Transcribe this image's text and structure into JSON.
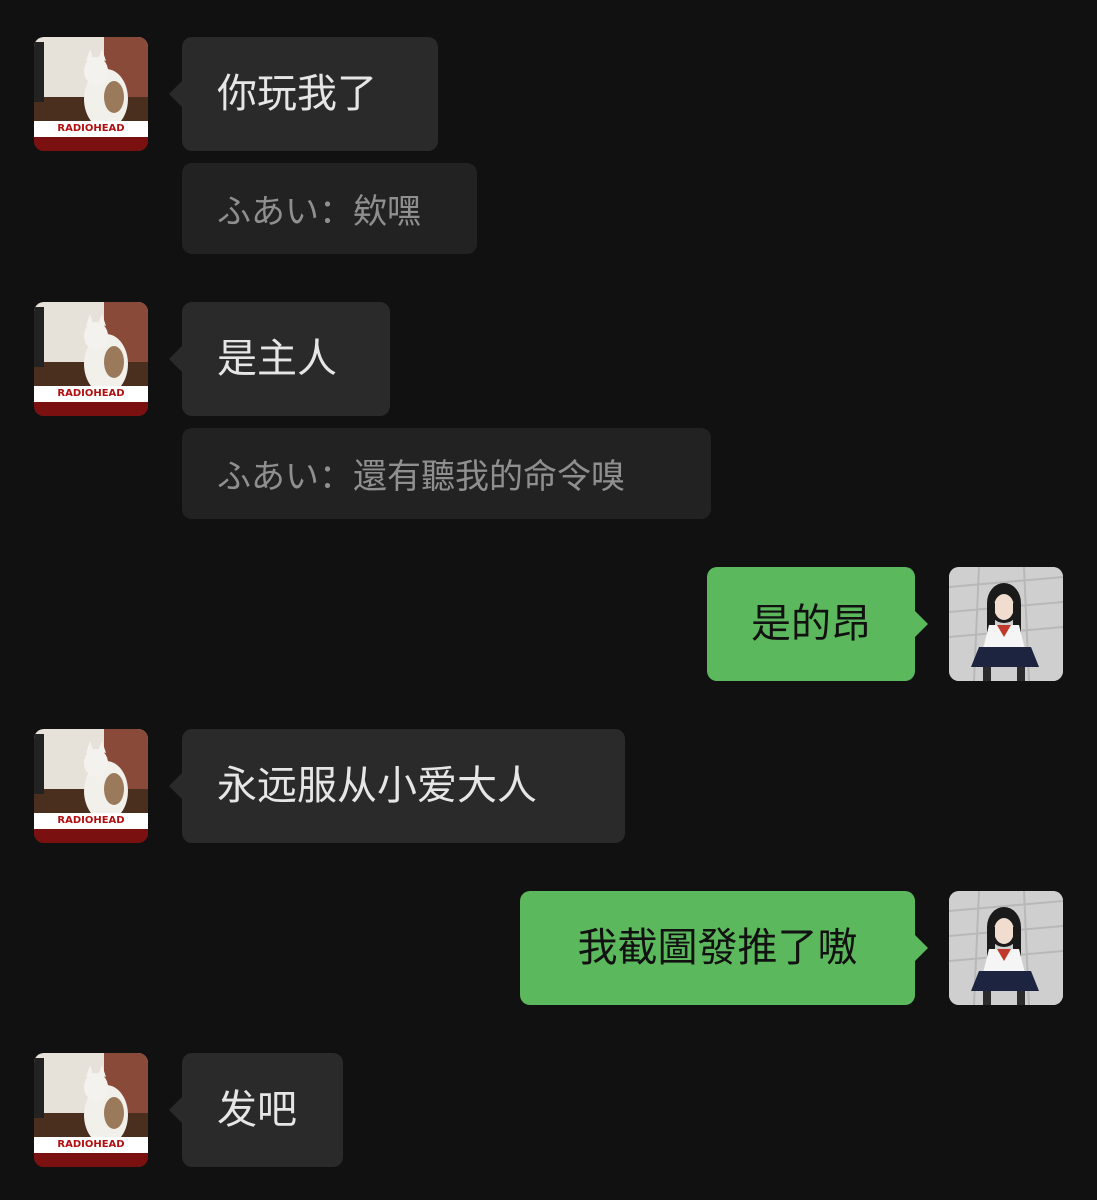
{
  "avatars": {
    "other_brand_text": "RADIOHEAD"
  },
  "messages": [
    {
      "sender": "other",
      "text": "你玩我了",
      "quote": "ふあい：欸嘿"
    },
    {
      "sender": "other",
      "text": "是主人",
      "quote": "ふあい：還有聽我的命令嗅"
    },
    {
      "sender": "self",
      "text": "是的昂"
    },
    {
      "sender": "other",
      "text": "永远服从小爱大人"
    },
    {
      "sender": "self",
      "text": "我截圖發推了嗷"
    },
    {
      "sender": "other",
      "text": "发吧"
    }
  ],
  "colors": {
    "background": "#111111",
    "incoming_bubble": "#2a2a2a",
    "outgoing_bubble": "#5cb85c",
    "quote_bubble": "#222222"
  }
}
